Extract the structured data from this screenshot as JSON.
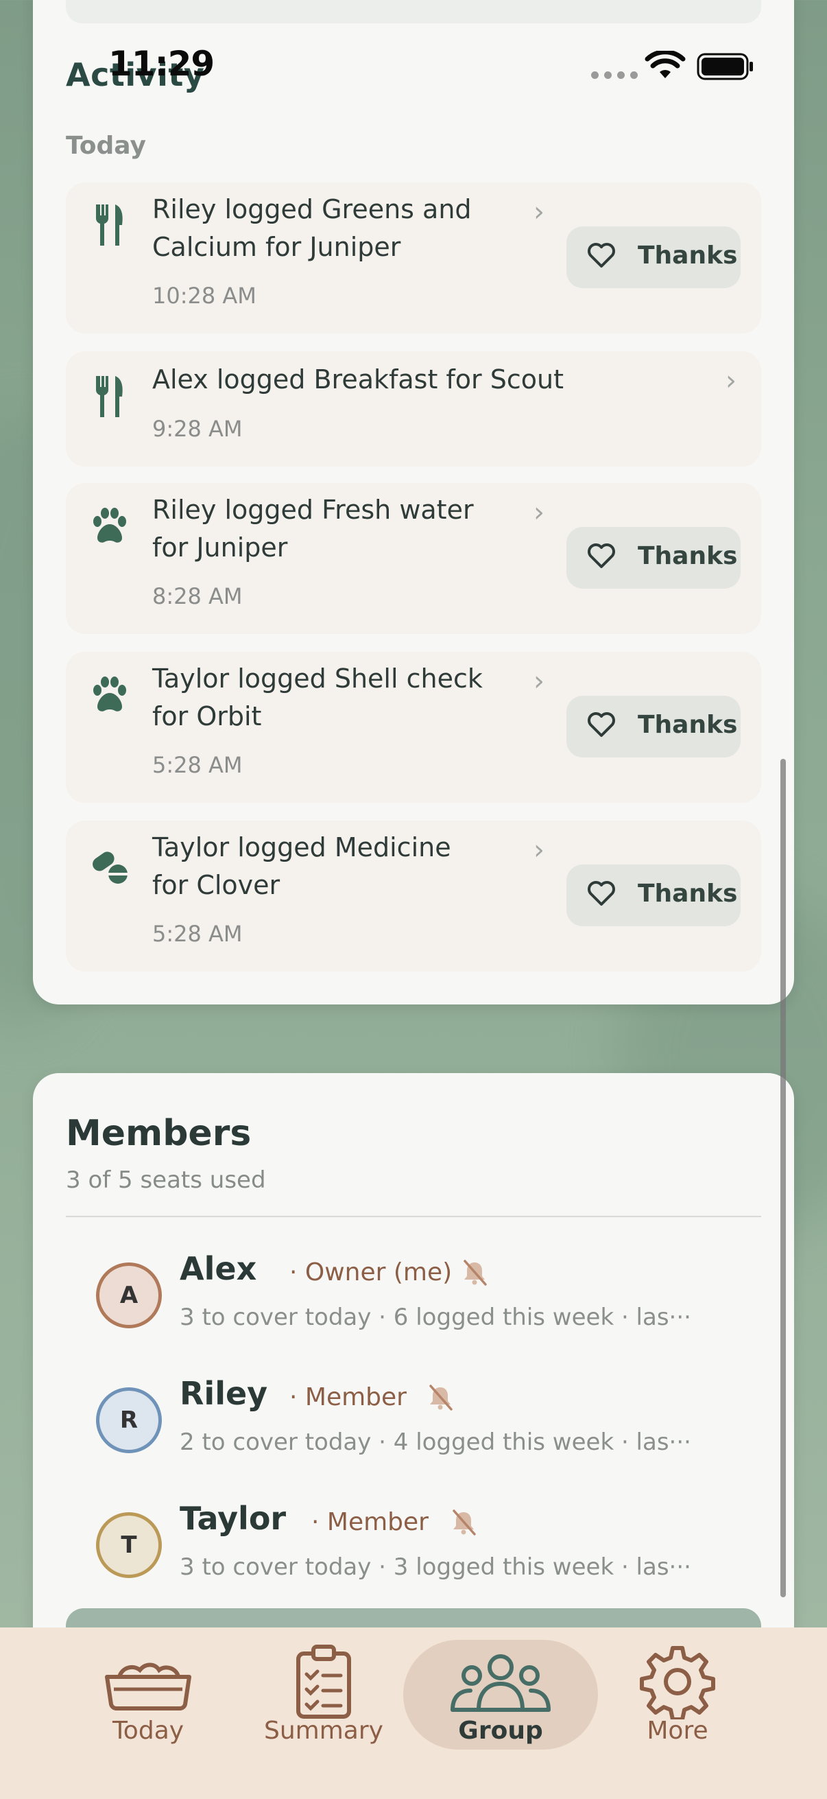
{
  "status_bar": {
    "time": "11:29"
  },
  "activity": {
    "title": "Activity",
    "group_label": "Today",
    "thanks_label": "Thanks",
    "items": [
      {
        "title_line1": "Riley logged Greens and",
        "title_line2": "Calcium for Juniper",
        "time": "10:28 AM",
        "icon": "fork-knife-icon",
        "has_thanks": true
      },
      {
        "title_line1": "Alex logged Breakfast for Scout",
        "title_line2": "",
        "time": "9:28 AM",
        "icon": "fork-knife-icon",
        "has_thanks": false
      },
      {
        "title_line1": "Riley logged Fresh water",
        "title_line2": "for Juniper",
        "time": "8:28 AM",
        "icon": "paw-icon",
        "has_thanks": true
      },
      {
        "title_line1": "Taylor logged Shell check",
        "title_line2": "for Orbit",
        "time": "5:28 AM",
        "icon": "paw-icon",
        "has_thanks": true
      },
      {
        "title_line1": "Taylor logged Medicine",
        "title_line2": "for Clover",
        "time": "5:28 AM",
        "icon": "pills-icon",
        "has_thanks": true
      }
    ]
  },
  "members": {
    "title": "Members",
    "subtitle": "3 of 5 seats used",
    "list": [
      {
        "initial": "A",
        "name": "Alex",
        "role": "· Owner (me)",
        "stats": "3 to cover today · 6 logged this week · las···",
        "color": "#b07a5a",
        "fill": "#ecdcd3"
      },
      {
        "initial": "R",
        "name": "Riley",
        "role": "· Member",
        "stats": "2 to cover today · 4 logged this week · las···",
        "color": "#6f93b8",
        "fill": "#dde5ee"
      },
      {
        "initial": "T",
        "name": "Taylor",
        "role": "· Member",
        "stats": "3 to cover today · 3 logged this week · las···",
        "color": "#bb9a58",
        "fill": "#ece5d3"
      }
    ]
  },
  "tabs": [
    {
      "label": "Today",
      "icon": "pet-bowl-icon",
      "active": false
    },
    {
      "label": "Summary",
      "icon": "clipboard-icon",
      "active": false
    },
    {
      "label": "Group",
      "icon": "group-icon",
      "active": true
    },
    {
      "label": "More",
      "icon": "gear-icon",
      "active": false
    }
  ],
  "colors": {
    "accent_green": "#3d6b57",
    "brown": "#8b5e45",
    "tab_bar": "#f3e4d8"
  }
}
